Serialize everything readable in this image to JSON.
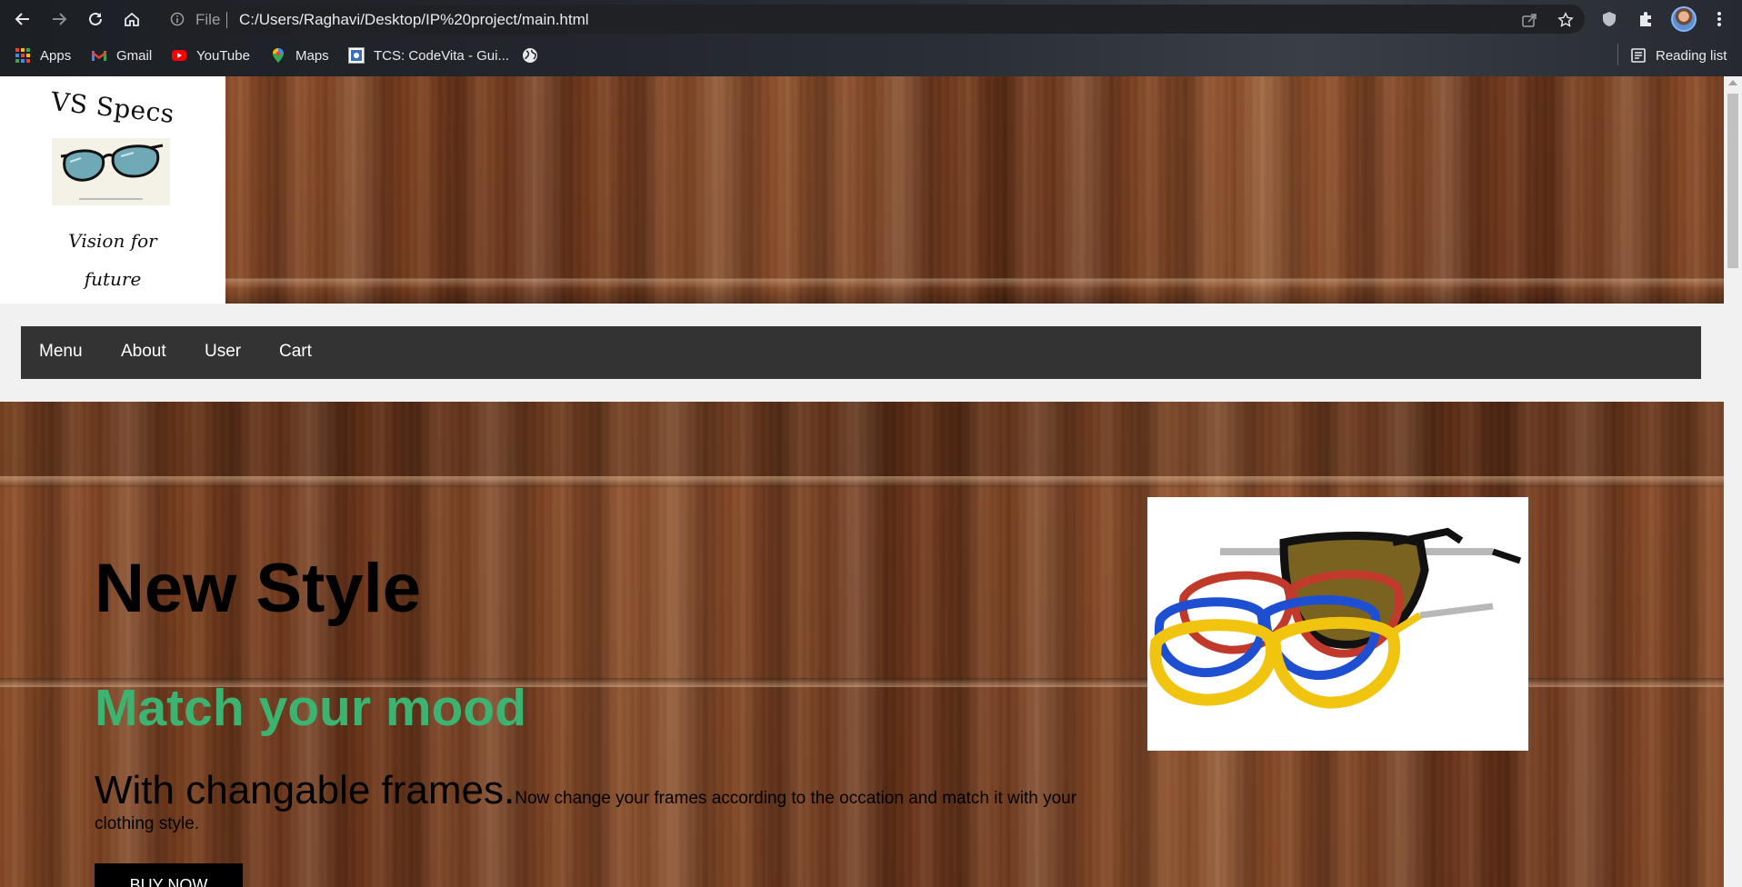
{
  "browser": {
    "omnibox": {
      "scheme_label": "File",
      "url": "C:/Users/Raghavi/Desktop/IP%20project/main.html"
    },
    "bookmarks": [
      {
        "label": "Apps",
        "icon": "apps-grid-icon"
      },
      {
        "label": "Gmail",
        "icon": "gmail-icon"
      },
      {
        "label": "YouTube",
        "icon": "youtube-icon"
      },
      {
        "label": "Maps",
        "icon": "maps-pin-icon"
      },
      {
        "label": "TCS: CodeVita - Gui...",
        "icon": "codevita-icon"
      },
      {
        "label": "",
        "icon": "globe-icon"
      }
    ],
    "reading_list_label": "Reading list",
    "accent_color": "#8ab4f8"
  },
  "site": {
    "logo": {
      "title": "VS Specs",
      "tagline_line1": "Vision for",
      "tagline_line2": "future"
    },
    "nav": {
      "items": [
        "Menu",
        "About",
        "User",
        "Cart"
      ],
      "bar_color": "#333333"
    },
    "hero": {
      "title": "New Style",
      "subtitle": "Match your mood",
      "subtitle_color": "#3cb371",
      "lead": "With changable frames.",
      "body": "Now change your frames according to the occation and match it with your clothing style.",
      "button": "BUY NOW"
    }
  }
}
